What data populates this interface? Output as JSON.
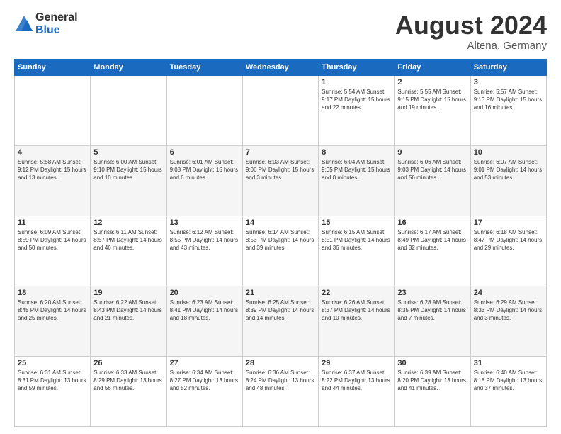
{
  "logo": {
    "general": "General",
    "blue": "Blue"
  },
  "title": "August 2024",
  "location": "Altena, Germany",
  "days_of_week": [
    "Sunday",
    "Monday",
    "Tuesday",
    "Wednesday",
    "Thursday",
    "Friday",
    "Saturday"
  ],
  "weeks": [
    [
      {
        "day": "",
        "info": ""
      },
      {
        "day": "",
        "info": ""
      },
      {
        "day": "",
        "info": ""
      },
      {
        "day": "",
        "info": ""
      },
      {
        "day": "1",
        "info": "Sunrise: 5:54 AM\nSunset: 9:17 PM\nDaylight: 15 hours\nand 22 minutes."
      },
      {
        "day": "2",
        "info": "Sunrise: 5:55 AM\nSunset: 9:15 PM\nDaylight: 15 hours\nand 19 minutes."
      },
      {
        "day": "3",
        "info": "Sunrise: 5:57 AM\nSunset: 9:13 PM\nDaylight: 15 hours\nand 16 minutes."
      }
    ],
    [
      {
        "day": "4",
        "info": "Sunrise: 5:58 AM\nSunset: 9:12 PM\nDaylight: 15 hours\nand 13 minutes."
      },
      {
        "day": "5",
        "info": "Sunrise: 6:00 AM\nSunset: 9:10 PM\nDaylight: 15 hours\nand 10 minutes."
      },
      {
        "day": "6",
        "info": "Sunrise: 6:01 AM\nSunset: 9:08 PM\nDaylight: 15 hours\nand 6 minutes."
      },
      {
        "day": "7",
        "info": "Sunrise: 6:03 AM\nSunset: 9:06 PM\nDaylight: 15 hours\nand 3 minutes."
      },
      {
        "day": "8",
        "info": "Sunrise: 6:04 AM\nSunset: 9:05 PM\nDaylight: 15 hours\nand 0 minutes."
      },
      {
        "day": "9",
        "info": "Sunrise: 6:06 AM\nSunset: 9:03 PM\nDaylight: 14 hours\nand 56 minutes."
      },
      {
        "day": "10",
        "info": "Sunrise: 6:07 AM\nSunset: 9:01 PM\nDaylight: 14 hours\nand 53 minutes."
      }
    ],
    [
      {
        "day": "11",
        "info": "Sunrise: 6:09 AM\nSunset: 8:59 PM\nDaylight: 14 hours\nand 50 minutes."
      },
      {
        "day": "12",
        "info": "Sunrise: 6:11 AM\nSunset: 8:57 PM\nDaylight: 14 hours\nand 46 minutes."
      },
      {
        "day": "13",
        "info": "Sunrise: 6:12 AM\nSunset: 8:55 PM\nDaylight: 14 hours\nand 43 minutes."
      },
      {
        "day": "14",
        "info": "Sunrise: 6:14 AM\nSunset: 8:53 PM\nDaylight: 14 hours\nand 39 minutes."
      },
      {
        "day": "15",
        "info": "Sunrise: 6:15 AM\nSunset: 8:51 PM\nDaylight: 14 hours\nand 36 minutes."
      },
      {
        "day": "16",
        "info": "Sunrise: 6:17 AM\nSunset: 8:49 PM\nDaylight: 14 hours\nand 32 minutes."
      },
      {
        "day": "17",
        "info": "Sunrise: 6:18 AM\nSunset: 8:47 PM\nDaylight: 14 hours\nand 29 minutes."
      }
    ],
    [
      {
        "day": "18",
        "info": "Sunrise: 6:20 AM\nSunset: 8:45 PM\nDaylight: 14 hours\nand 25 minutes."
      },
      {
        "day": "19",
        "info": "Sunrise: 6:22 AM\nSunset: 8:43 PM\nDaylight: 14 hours\nand 21 minutes."
      },
      {
        "day": "20",
        "info": "Sunrise: 6:23 AM\nSunset: 8:41 PM\nDaylight: 14 hours\nand 18 minutes."
      },
      {
        "day": "21",
        "info": "Sunrise: 6:25 AM\nSunset: 8:39 PM\nDaylight: 14 hours\nand 14 minutes."
      },
      {
        "day": "22",
        "info": "Sunrise: 6:26 AM\nSunset: 8:37 PM\nDaylight: 14 hours\nand 10 minutes."
      },
      {
        "day": "23",
        "info": "Sunrise: 6:28 AM\nSunset: 8:35 PM\nDaylight: 14 hours\nand 7 minutes."
      },
      {
        "day": "24",
        "info": "Sunrise: 6:29 AM\nSunset: 8:33 PM\nDaylight: 14 hours\nand 3 minutes."
      }
    ],
    [
      {
        "day": "25",
        "info": "Sunrise: 6:31 AM\nSunset: 8:31 PM\nDaylight: 13 hours\nand 59 minutes."
      },
      {
        "day": "26",
        "info": "Sunrise: 6:33 AM\nSunset: 8:29 PM\nDaylight: 13 hours\nand 56 minutes."
      },
      {
        "day": "27",
        "info": "Sunrise: 6:34 AM\nSunset: 8:27 PM\nDaylight: 13 hours\nand 52 minutes."
      },
      {
        "day": "28",
        "info": "Sunrise: 6:36 AM\nSunset: 8:24 PM\nDaylight: 13 hours\nand 48 minutes."
      },
      {
        "day": "29",
        "info": "Sunrise: 6:37 AM\nSunset: 8:22 PM\nDaylight: 13 hours\nand 44 minutes."
      },
      {
        "day": "30",
        "info": "Sunrise: 6:39 AM\nSunset: 8:20 PM\nDaylight: 13 hours\nand 41 minutes."
      },
      {
        "day": "31",
        "info": "Sunrise: 6:40 AM\nSunset: 8:18 PM\nDaylight: 13 hours\nand 37 minutes."
      }
    ]
  ]
}
